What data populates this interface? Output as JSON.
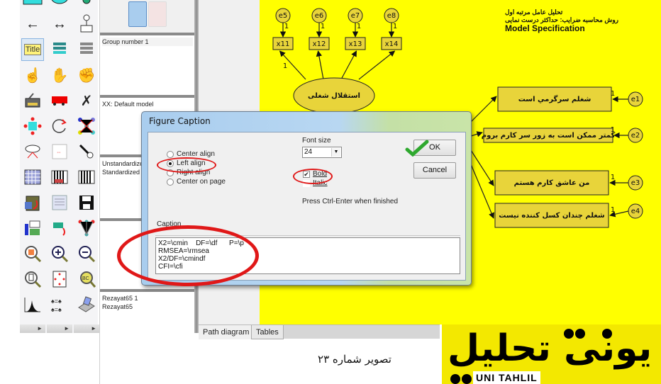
{
  "toolbox": {
    "columns": [
      [
        "rectangle-tool",
        "arrow-left-tool",
        "title-tool",
        "select-one-tool",
        "printer-tool",
        "move-parameters-tool",
        "ellipse-indicator-tool",
        "data-files-tool",
        "analysis-properties-tool",
        "text-output-tool",
        "zoom-select-tool",
        "zoom-page-tool",
        "histogram-tool"
      ],
      [
        "ellipse-tool",
        "covariance-tool",
        "list-variables-model-tool",
        "select-all-tool",
        "move-tool",
        "rotate-tool",
        "fit-to-page-tool",
        "list-variables-data-tool",
        "spreadsheet-tool",
        "drag-properties-tool",
        "zoom-in-tool",
        "page-tool",
        "multigroup-tool"
      ],
      [
        "indicator-tool",
        "unique-variable-tool",
        "list-variables-tool",
        "deselect-all-tool",
        "erase-tool",
        "reflect-tool",
        "touch-up-tool",
        "calculate-estimates-tool",
        "save-tool",
        "specification-search-tool",
        "zoom-out-tool",
        "loupe-tool",
        "print-tool"
      ]
    ],
    "title_tool_label": "Title"
  },
  "panels": {
    "groups": {
      "items": [
        "Group number 1"
      ]
    },
    "models": {
      "items": [
        "XX: Default model"
      ]
    },
    "estimates": {
      "items": [
        "Unstandardized estimates",
        "Standardized estimates"
      ]
    },
    "files": {
      "items": [
        "Rezayat65 1",
        "Rezayat65"
      ]
    }
  },
  "tabs": [
    {
      "label": "Path diagram",
      "active": true
    },
    {
      "label": "Tables",
      "active": false
    }
  ],
  "diagram": {
    "header": {
      "line1": "تحلیل عامل مرتبه اول",
      "line2": "روش محاسبه ضرایب: حداکثر درست نمایی",
      "line3": "Model Specification"
    },
    "latent": "استقلال شغلی",
    "top_errors": [
      "e5",
      "e6",
      "e7",
      "e8"
    ],
    "top_indicators": [
      "x11",
      "x12",
      "x13",
      "x14"
    ],
    "right_items": [
      {
        "label": "شغلم سرگرمي است",
        "error": "e1"
      },
      {
        "label": "کمتر ممکن است به زور  سر کارم بروم",
        "error": "e2"
      },
      {
        "label": "من عاشق کارم هستم",
        "error": "e3"
      },
      {
        "label": "شغلم چندان کسل کننده نیست",
        "error": "e4"
      }
    ],
    "path_weight": "1",
    "colors": {
      "background": "#ffff00",
      "node_fill": "#e8d43a",
      "stroke": "#222222"
    }
  },
  "dialog": {
    "title": "Figure Caption",
    "alignment": {
      "options": [
        "Center align",
        "Left align",
        "Right align",
        "Center on page"
      ],
      "selected": "Left align"
    },
    "font_size_label": "Font size",
    "font_size_value": "24",
    "bold_label": "Bold",
    "bold_checked": true,
    "italic_label": "Italic",
    "italic_checked": false,
    "hint": "Press Ctrl-Enter when finished",
    "ok_label": "OK",
    "cancel_label": "Cancel",
    "caption_label": "Caption",
    "caption_value": "X2=\\cmin    DF=\\df      P=\\p\nRMSEA=\\rmsea\nX2/DF=\\cmindf\nCFI=\\cfi"
  },
  "figure_caption": "تصویر شماره ۲۳",
  "logo": {
    "text": "یونی تحلیل",
    "latin": "UNI TAHLIL",
    "color": "#f3e800"
  }
}
